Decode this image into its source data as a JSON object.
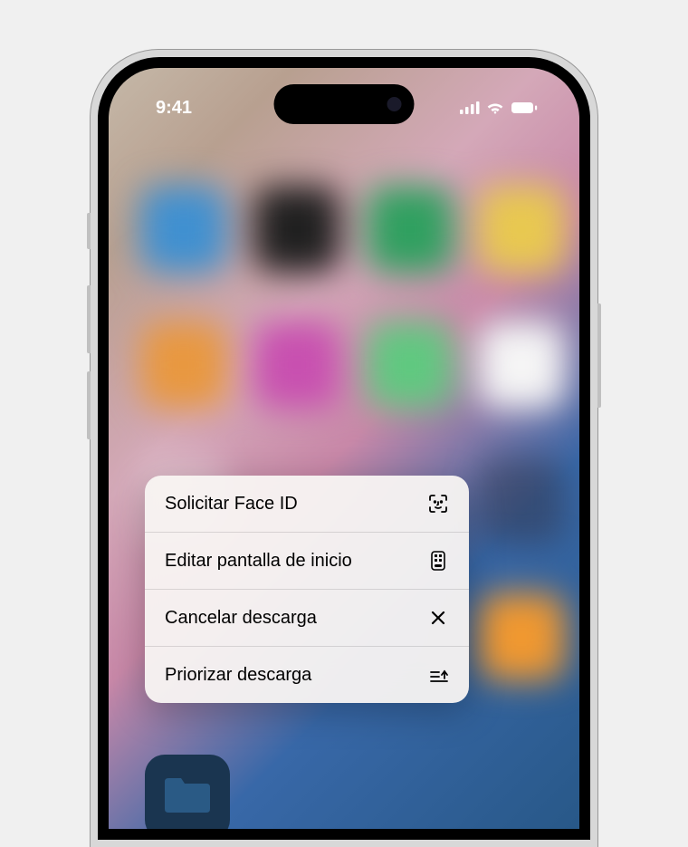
{
  "status_bar": {
    "time": "9:41"
  },
  "context_menu": {
    "items": [
      {
        "label": "Solicitar Face ID",
        "icon": "faceid-icon"
      },
      {
        "label": "Editar pantalla de inicio",
        "icon": "homescreen-edit-icon"
      },
      {
        "label": "Cancelar descarga",
        "icon": "close-icon"
      },
      {
        "label": "Priorizar descarga",
        "icon": "prioritize-icon"
      }
    ]
  },
  "visible_app": {
    "icon": "folder-icon"
  }
}
